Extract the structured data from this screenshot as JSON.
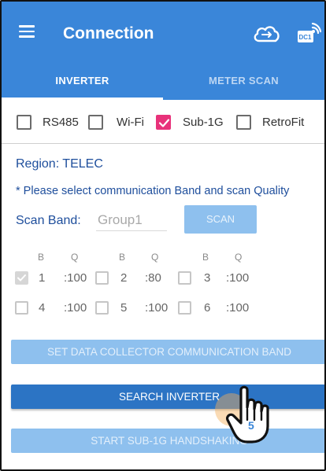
{
  "app_bar": {
    "title": "Connection",
    "menu_icon": "menu-icon",
    "cloud_icon": "cloud-sync-icon",
    "dc_icon": "data-collector-wifi-icon",
    "dc_badge": "DC1",
    "color": "#3a86d9"
  },
  "tabs": [
    {
      "label": "INVERTER",
      "active": true
    },
    {
      "label": "METER SCAN",
      "active": false
    }
  ],
  "modes": [
    {
      "label": "RS485",
      "checked": false
    },
    {
      "label": "Wi-Fi",
      "checked": false
    },
    {
      "label": "Sub-1G",
      "checked": true
    },
    {
      "label": "RetroFit",
      "checked": false
    }
  ],
  "region": {
    "text": "Region:  TELEC"
  },
  "notice": "* Please select communication Band and scan Quality",
  "scan_band": {
    "label": "Scan Band:",
    "value": "Group1",
    "button": "SCAN"
  },
  "band_grid": {
    "headers": [
      "B",
      "Q"
    ],
    "cells": [
      {
        "band": "1",
        "quality": ":100",
        "checked": true
      },
      {
        "band": "2",
        "quality": ":80",
        "checked": false
      },
      {
        "band": "3",
        "quality": ":100",
        "checked": false
      },
      {
        "band": "4",
        "quality": ":100",
        "checked": false
      },
      {
        "band": "5",
        "quality": ":100",
        "checked": false
      },
      {
        "band": "6",
        "quality": ":100",
        "checked": false
      }
    ]
  },
  "buttons": {
    "set_band": "SET DATA COLLECTOR COMMUNICATION BAND",
    "search": "SEARCH INVERTER",
    "handshake": "START SUB-1G HANDSHAKING"
  },
  "overlay": {
    "step_number": "5",
    "icon": "hand-pointer-icon"
  }
}
